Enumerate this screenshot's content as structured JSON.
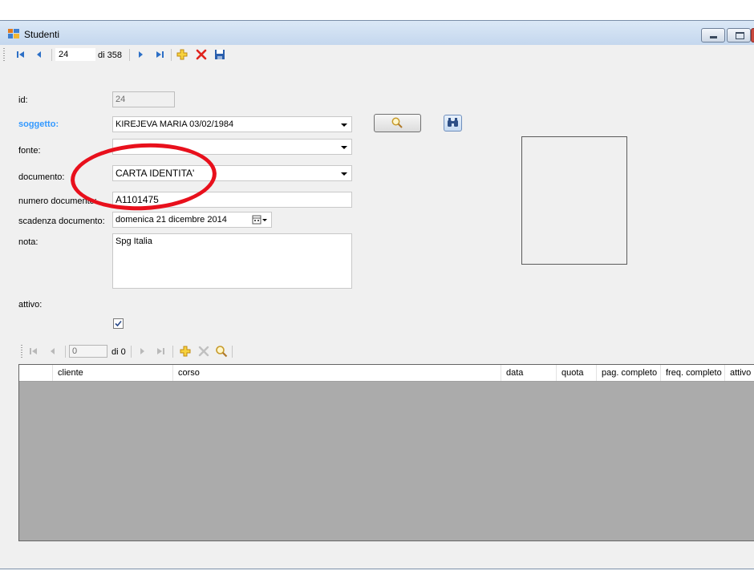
{
  "window": {
    "title": "Studenti"
  },
  "toolbar": {
    "record_position": "24",
    "record_count": "di 358"
  },
  "form": {
    "id_label": "id:",
    "id_value": "24",
    "soggetto_label": "soggetto:",
    "soggetto_value": "KIREJEVA MARIA 03/02/1984",
    "fonte_label": "fonte:",
    "fonte_value": "",
    "documento_label": "documento:",
    "documento_value": "CARTA  IDENTITA'",
    "numero_label": "numero documento:",
    "numero_value": "A1101475",
    "scadenza_label": "scadenza documento:",
    "scadenza_value": "domenica 21  dicembre  2014",
    "nota_label": "nota:",
    "nota_value": "Spg Italia",
    "attivo_label": "attivo:",
    "attivo_checked": true
  },
  "subgrid": {
    "toolbar": {
      "record_position": "0",
      "record_count": "di 0"
    },
    "columns": [
      "cliente",
      "corso",
      "data",
      "quota",
      "pag. completo",
      "freq. completo",
      "attivo"
    ],
    "rows": []
  },
  "colors": {
    "accent": "#3399ff",
    "annotation": "#e8101c",
    "grid_bg": "#ababab"
  }
}
